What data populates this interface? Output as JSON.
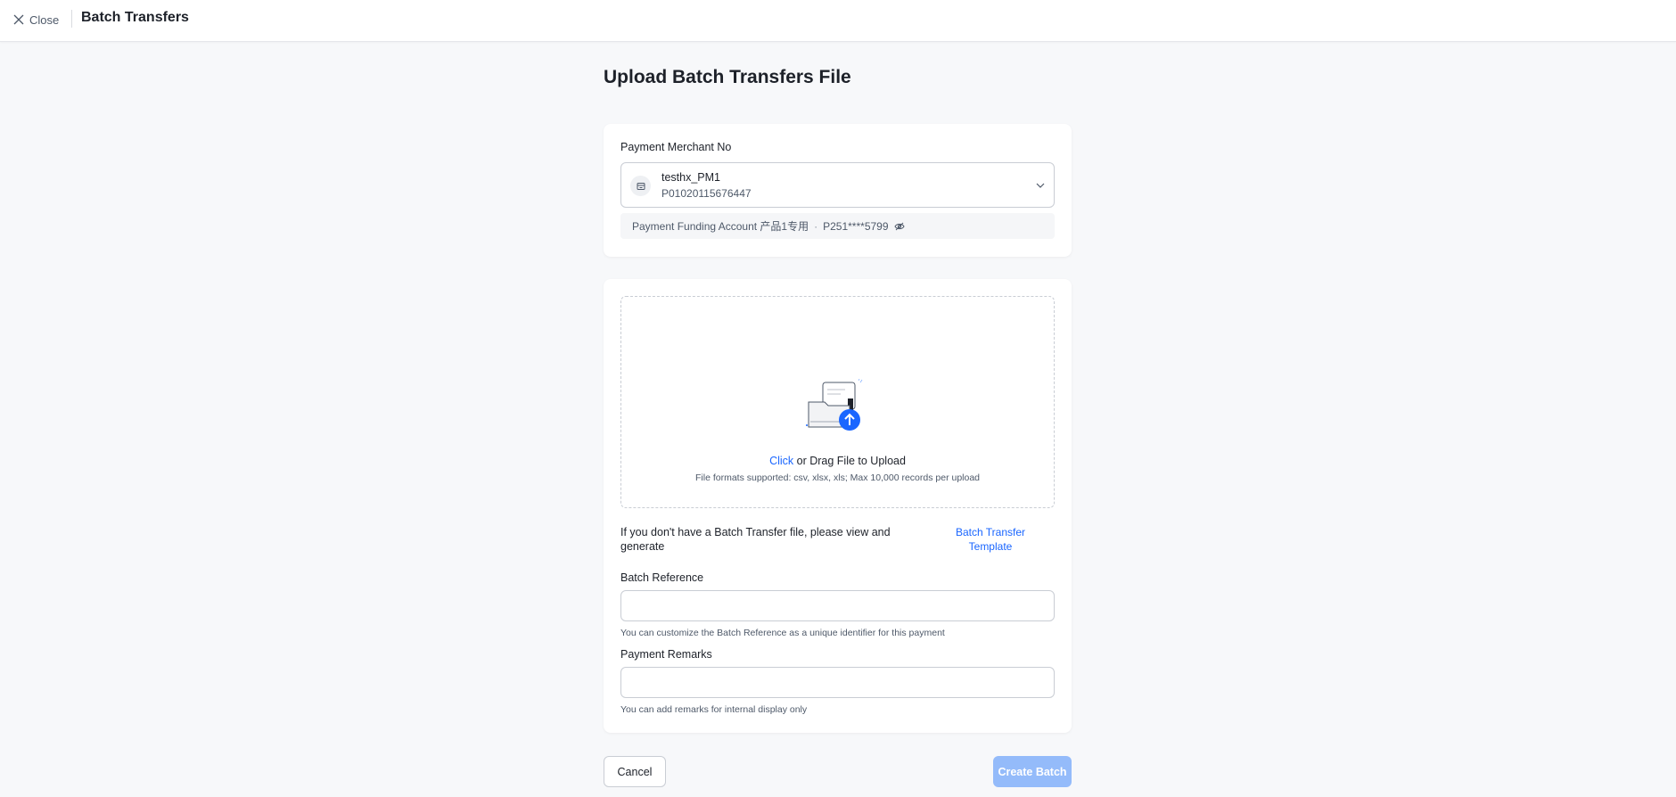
{
  "header": {
    "close_label": "Close",
    "title": "Batch Transfers"
  },
  "page": {
    "title": "Upload Batch Transfers File"
  },
  "merchant": {
    "label": "Payment Merchant No",
    "name": "testhx_PM1",
    "number": "P01020115676447",
    "funding_account_label": "Payment Funding Account 产品1专用",
    "funding_separator": "·",
    "funding_account_masked": "P251****5799"
  },
  "upload": {
    "click_label": "Click",
    "drag_label": "or Drag File to Upload",
    "formats_hint": "File formats supported: csv, xlsx, xls; Max 10,000 records per upload"
  },
  "template": {
    "prompt": "If you don't have a Batch Transfer file, please view and generate",
    "link_label": "Batch Transfer Template"
  },
  "batch_reference": {
    "label": "Batch Reference",
    "value": "",
    "help": "You can customize the Batch Reference as a unique identifier for this payment"
  },
  "payment_remarks": {
    "label": "Payment Remarks",
    "value": "",
    "help": "You can add remarks for internal display only"
  },
  "actions": {
    "cancel_label": "Cancel",
    "create_label": "Create Batch"
  },
  "colors": {
    "accent": "#1a66ff",
    "create_disabled": "#94bbfa",
    "background": "#f7f8fa"
  },
  "icons": {
    "close": "close-icon",
    "merchant": "merchant-icon",
    "chevron": "chevron-down-icon",
    "eye": "eye-off-icon",
    "upload": "folder-upload-icon"
  }
}
